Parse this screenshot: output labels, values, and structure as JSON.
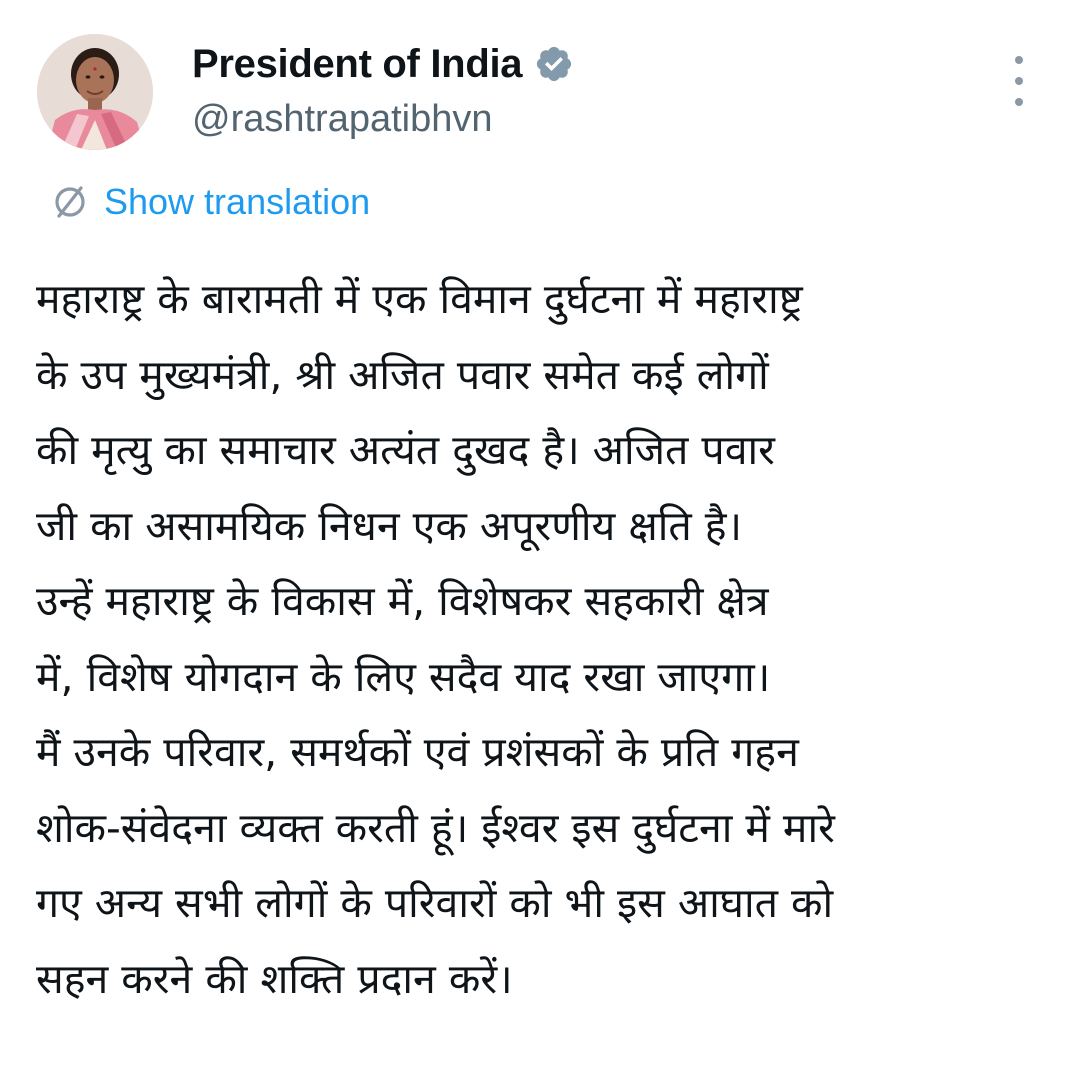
{
  "author": {
    "display_name": "President of India",
    "handle": "@rashtrapatibhvn",
    "verified_badge": "verified-badge-icon",
    "verified_color": "#829aab",
    "avatar": "profile-photo"
  },
  "actions": {
    "more_icon": "more-vertical-icon"
  },
  "translation": {
    "icon": "globe-translate-icon",
    "label": "Show translation",
    "link_color": "#1d9bf0"
  },
  "tweet": {
    "lines": [
      "महाराष्ट्र के बारामती में एक विमान दुर्घटना में महाराष्ट्र",
      "के उप मुख्यमंत्री, श्री अजित पवार समेत कई लोगों",
      "की मृत्यु का समाचार अत्यंत दुखद है। अजित पवार",
      "जी का असामयिक निधन एक अपूरणीय क्षति है।",
      "उन्हें महाराष्ट्र के विकास में, विशेषकर सहकारी क्षेत्र",
      "में, विशेष योगदान के लिए सदैव याद रखा जाएगा।",
      "मैं उनके परिवार, समर्थकों एवं प्रशंसकों के प्रति गहन",
      "शोक-संवेदना व्यक्त करती हूं। ईश्वर इस दुर्घटना में मारे",
      "गए अन्य सभी लोगों के परिवारों को भी इस आघात को",
      "सहन करने की शक्ति प्रदान करें।"
    ]
  }
}
